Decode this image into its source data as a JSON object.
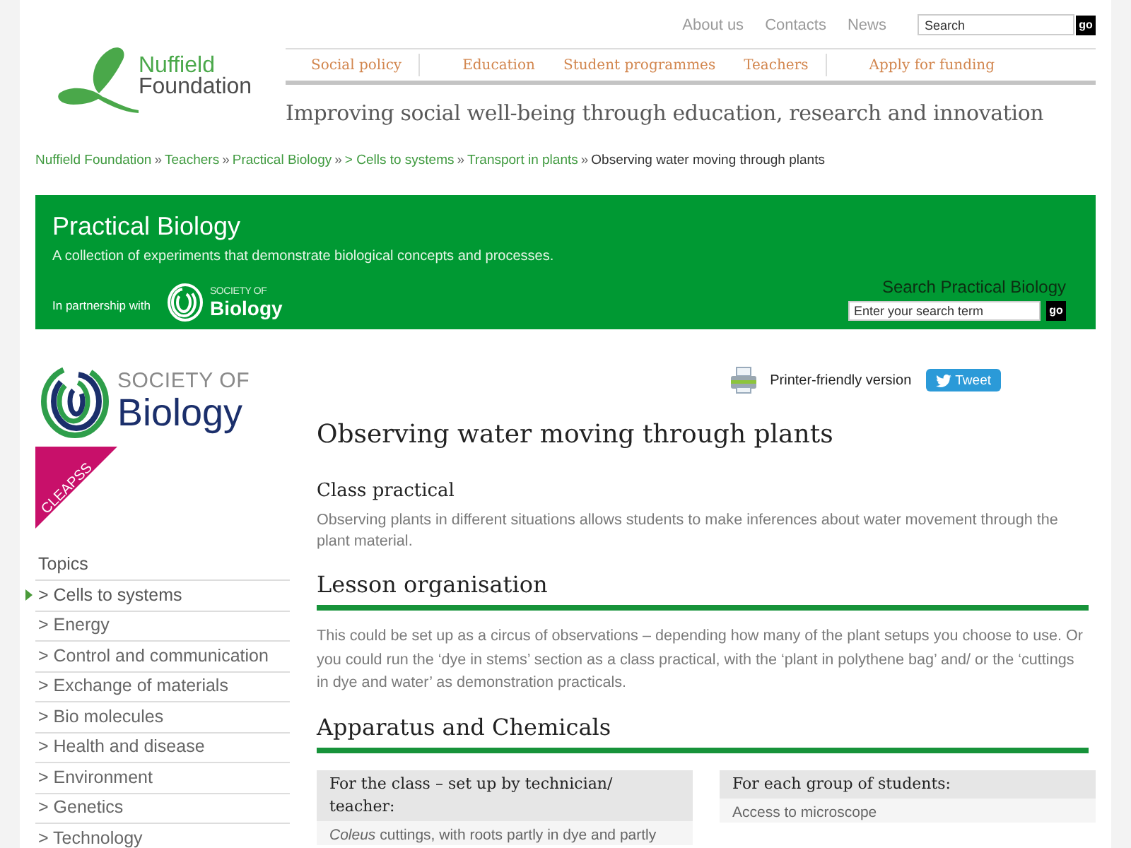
{
  "header": {
    "logo": {
      "line1": "Nuffield",
      "line2": "Foundation"
    },
    "top_links": [
      "About us",
      "Contacts",
      "News"
    ],
    "search": {
      "placeholder": "Search",
      "button": "go"
    },
    "nav": [
      {
        "items": [
          "Social policy"
        ]
      },
      {
        "items": [
          "Education",
          "Student programmes",
          "Teachers"
        ]
      },
      {
        "items": [
          "Apply for funding"
        ]
      }
    ],
    "tagline": "Improving social well-being through education, research and innovation"
  },
  "breadcrumb": [
    {
      "kind": "link",
      "label": "Nuffield Foundation"
    },
    {
      "kind": "separator",
      "label": "»"
    },
    {
      "kind": "link",
      "label": "Teachers"
    },
    {
      "kind": "separator",
      "label": "»"
    },
    {
      "kind": "link",
      "label": "Practical Biology"
    },
    {
      "kind": "separator",
      "label": "»"
    },
    {
      "kind": "link",
      "label": "> Cells to systems"
    },
    {
      "kind": "separator",
      "label": "»"
    },
    {
      "kind": "link",
      "label": "Transport in plants"
    },
    {
      "kind": "separator",
      "label": "»"
    },
    {
      "kind": "current",
      "label": "Observing water moving through plants"
    }
  ],
  "banner": {
    "title": "Practical Biology",
    "subtitle": "A collection of experiments that demonstrate biological concepts and processes.",
    "partnership_label": "In partnership with",
    "partner_logo": {
      "line1": "SOCIETY OF",
      "line2": "Biology"
    },
    "search": {
      "label": "Search Practical Biology",
      "placeholder": "Enter your search term",
      "button": "go"
    }
  },
  "sidebar": {
    "logo": {
      "line1": "SOCIETY OF",
      "line2": "Biology"
    },
    "cleapss_logo": "CLEAPSS",
    "topics_heading": "Topics",
    "topics": [
      {
        "label": "> Cells to systems",
        "selected": true
      },
      {
        "label": "> Energy",
        "selected": false
      },
      {
        "label": "> Control and communication",
        "selected": false
      },
      {
        "label": "> Exchange of materials",
        "selected": false
      },
      {
        "label": "> Bio molecules",
        "selected": false
      },
      {
        "label": "> Health and disease",
        "selected": false
      },
      {
        "label": "> Environment",
        "selected": false
      },
      {
        "label": "> Genetics",
        "selected": false
      },
      {
        "label": "> Technology",
        "selected": false
      }
    ]
  },
  "main": {
    "printer_link": "Printer-friendly version",
    "tweet_button": "Tweet",
    "title": "Observing water moving through plants",
    "sections": [
      {
        "kind": "subheading",
        "heading": "Class practical",
        "text": "Observing plants in different situations allows students to make inferences about water movement through the plant material."
      },
      {
        "kind": "ruled",
        "heading": "Lesson organisation",
        "text": "This could be set up as a circus of observations – depending how many of the plant setups you choose to use. Or you could run the ‘dye in stems’ section as a class practical, with the ‘plant in polythene bag’ and/ or the ‘cuttings in dye and water’ as demonstration practicals."
      },
      {
        "kind": "ruled",
        "heading": "Apparatus and Chemicals"
      }
    ],
    "apparatus": [
      {
        "heading": "For the class – set up by technician/ teacher:",
        "items": [
          "*Coleus* cuttings, with roots partly in dye and partly"
        ]
      },
      {
        "heading": "For each group of students:",
        "items": [
          "Access to microscope"
        ]
      }
    ]
  }
}
